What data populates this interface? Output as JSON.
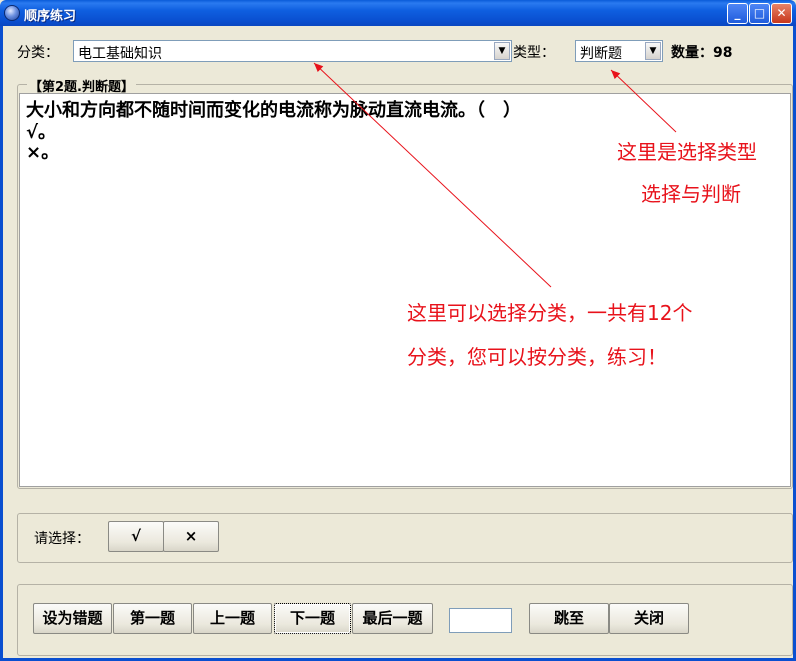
{
  "window": {
    "title": "顺序练习",
    "controls": {
      "minimize": "_",
      "maximize": "□",
      "close": "✕"
    },
    "icon": "app-icon"
  },
  "filter": {
    "category_label": "分类：",
    "category_value": "电工基础知识",
    "type_label": "类型：",
    "type_value": "判断题",
    "count_label": "数量：",
    "count_value": "98"
  },
  "question": {
    "group_title": "【第2题.判断题】",
    "text": "大小和方向都不随时间而变化的电流称为脉动直流电流。（　）",
    "options": [
      "√。",
      "×。"
    ]
  },
  "answer": {
    "prompt": "请选择：",
    "buttons": [
      "√",
      "×"
    ]
  },
  "navigation": {
    "buttons": [
      "设为错题",
      "第一题",
      "上一题",
      "下一题",
      "最后一题"
    ],
    "jump_input_value": "",
    "jump_button": "跳至",
    "close_button": "关闭"
  },
  "annotations": {
    "type_note_line1": "这里是选择类型",
    "type_note_line2": "选择与判断",
    "category_note_line1": "这里可以选择分类，一共有12个",
    "category_note_line2": "分类，您可以按分类，练习！",
    "color": "#e8121b"
  },
  "colors": {
    "titlebar": "#0a4fd0",
    "window_bg": "#ece9d8",
    "annotation": "#e8121b"
  }
}
